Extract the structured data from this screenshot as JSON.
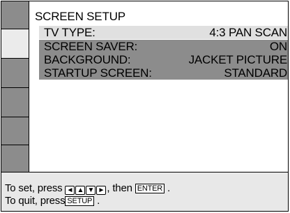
{
  "menu": {
    "title": "SCREEN SETUP",
    "items": [
      {
        "label": "TV TYPE:",
        "value": "4:3 PAN SCAN"
      },
      {
        "label": "SCREEN SAVER:",
        "value": "ON"
      },
      {
        "label": "BACKGROUND:",
        "value": "JACKET PICTURE"
      },
      {
        "label": "STARTUP SCREEN:",
        "value": "STANDARD"
      }
    ]
  },
  "footer": {
    "set_prefix": "To set, press",
    "set_middle": ", then",
    "enter_label": "ENTER",
    "set_suffix": ".",
    "quit_prefix": "To quit, press",
    "setup_label": "SETUP",
    "quit_suffix": "."
  },
  "keys": {
    "left": "◄",
    "up": "▲",
    "down": "▼",
    "right": "►"
  },
  "colors": {
    "selected_row": "#e0e0e0",
    "row": "#8c8c8c",
    "footer": "#e8e8e8"
  }
}
